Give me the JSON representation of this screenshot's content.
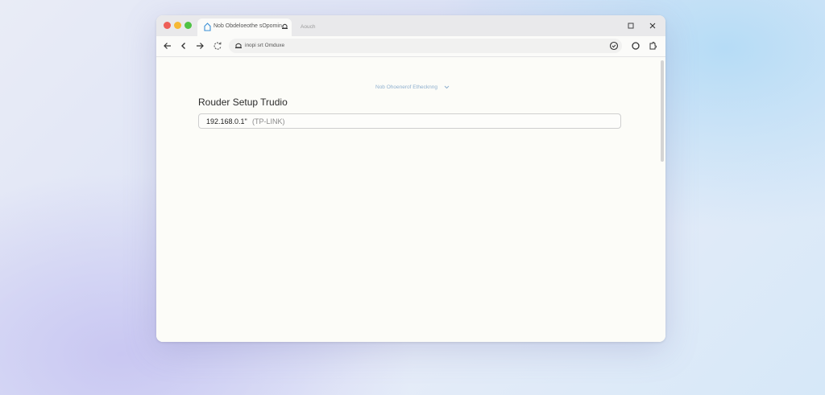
{
  "tabs": [
    {
      "title": "Nob Obdeloeothe sOpomin"
    },
    {
      "title": "Aouch"
    }
  ],
  "toolbar": {
    "url": "inopi srt Omduxe"
  },
  "page": {
    "language_selector": "Nob Ohoenerof Ethecknng",
    "title": "Rouder Setup Trudio",
    "router_field": {
      "value": "192.168.0.1\"",
      "hint": "(TP-LINK)"
    }
  },
  "colors": {
    "close": "#ee5f57",
    "minimize": "#f6b935",
    "maximize": "#4fc244",
    "link": "#8fb0cf"
  },
  "icons": {
    "tab": "home-icon",
    "tab_close": "bell-icon",
    "url": "bell-icon",
    "nav": [
      "back-icon",
      "chevron-left-icon",
      "forward-icon",
      "refresh-icon"
    ],
    "toolbar_right": [
      "shield-icon",
      "circle-icon",
      "puzzle-icon"
    ]
  }
}
